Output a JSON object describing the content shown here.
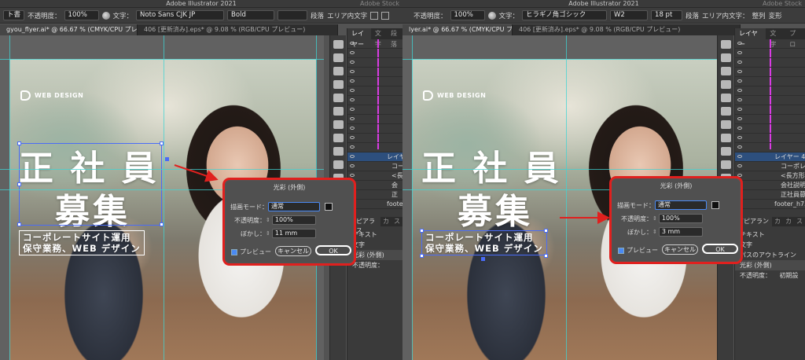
{
  "app": {
    "title": "Adobe Illustrator 2021",
    "stock": "Adobe Stock"
  },
  "colors": {
    "highlight": "#e0201e",
    "guide": "#3fd4d4",
    "selection": "#4a6cf7",
    "layer_color": "#d93be3"
  },
  "left": {
    "control": {
      "style_label": "ト書",
      "opacity_label": "不透明度：",
      "opacity_value": "100%",
      "text_label": "文字：",
      "font": "Noto Sans CJK JP",
      "weight": "Bold",
      "paragraph": "段落",
      "area_type": "エリア内文字"
    },
    "tabs": [
      "gyou_flyer.ai* @ 66.67 % (CMYK/CPU プレビュー)",
      "406 [更新済み].eps* @ 9.08 % (RGB/CPU プレビュー)"
    ],
    "artboard": {
      "logo": "WEB DESIGN",
      "headline1": "正 社 員",
      "headline2": "募集",
      "sub1": "コーポレートサイト運用",
      "sub2": "保守業務、WEB デザイン"
    },
    "panel": {
      "tabs": [
        "レイヤー",
        "文字",
        "段落"
      ],
      "layer_name": "レイヤー",
      "sub_layers": [
        "コー",
        "<長",
        "会",
        "正"
      ],
      "footer_layer": "footer",
      "appearance_tabs": [
        "アピアランス",
        "カ",
        "ス"
      ],
      "appearance_rows": [
        "テキスト",
        "文字",
        "光彩 (外側)",
        "不透明度："
      ]
    },
    "dialog": {
      "title": "光彩 (外側)",
      "mode_label": "描画モード：",
      "mode_value": "通常",
      "opacity_label": "不透明度：",
      "opacity_value": "100%",
      "blur_label": "ぼかし：",
      "blur_value": "11 mm",
      "preview_label": "プレビュー",
      "cancel_label": "キャンセル",
      "ok_label": "OK"
    }
  },
  "right": {
    "control": {
      "opacity_label": "不透明度：",
      "opacity_value": "100%",
      "text_label": "文字：",
      "font": "ヒラギノ角ゴシック",
      "weight": "W2",
      "size": "18 pt",
      "paragraph": "段落",
      "area_type": "エリア内文字：",
      "align": "整列",
      "transform": "変形"
    },
    "tabs": [
      "lyer.ai* @ 66.67 % (CMYK/CPU プレビュー)",
      "406 [更新済み].eps* @ 9.08 % (RGB/CPU プレビュー)"
    ],
    "artboard": {
      "logo": "WEB DESIGN",
      "headline1": "正 社 員",
      "headline2": "募集",
      "sub1": "コーポレートサイト運用",
      "sub2": "保守業務、WEB デザイン"
    },
    "panel": {
      "tabs": [
        "レイヤー",
        "文字",
        "プロ"
      ],
      "layer_name": "レイヤー 4",
      "sub_layers": [
        "コーポレ",
        "<長方形>",
        "会社説明",
        "正社員募"
      ],
      "footer_layer": "footer_h75",
      "appearance_tabs": [
        "アピアランス",
        "カ",
        "カ",
        "ス"
      ],
      "appearance_rows": [
        "テキスト",
        "文字",
        "パスのアウトライン",
        "光彩 (外側)",
        "不透明度："
      ],
      "opacity_default": "初期設"
    },
    "dialog": {
      "title": "光彩 (外側)",
      "mode_label": "描画モード：",
      "mode_value": "通常",
      "opacity_label": "不透明度：",
      "opacity_value": "100%",
      "blur_label": "ぼかし：",
      "blur_value": "3 mm",
      "preview_label": "プレビュー",
      "cancel_label": "キャンセル",
      "ok_label": "OK"
    }
  }
}
